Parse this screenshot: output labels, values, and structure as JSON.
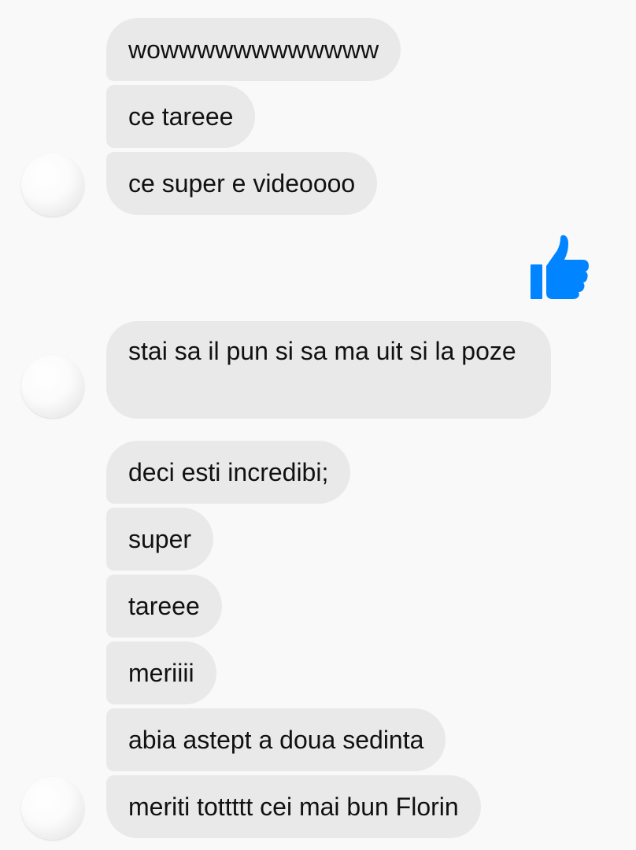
{
  "colors": {
    "background": "#f9f9f9",
    "bubble": "#e9e9e9",
    "text": "#111111",
    "like": "#0084ff"
  },
  "messages": [
    {
      "text": "wowwwwwwwwwwww"
    },
    {
      "text": "ce tareee"
    },
    {
      "text": "ce super e videoooo"
    },
    {
      "text": "stai sa il pun si sa ma uit si la poze"
    },
    {
      "text": "deci esti incredibi;"
    },
    {
      "text": "super"
    },
    {
      "text": "tareee"
    },
    {
      "text": "meriiii"
    },
    {
      "text": "abia astept a doua sedinta"
    },
    {
      "text": "meriti tottttt cei mai bun Florin"
    }
  ],
  "reaction": {
    "icon": "thumbs-up-icon"
  }
}
